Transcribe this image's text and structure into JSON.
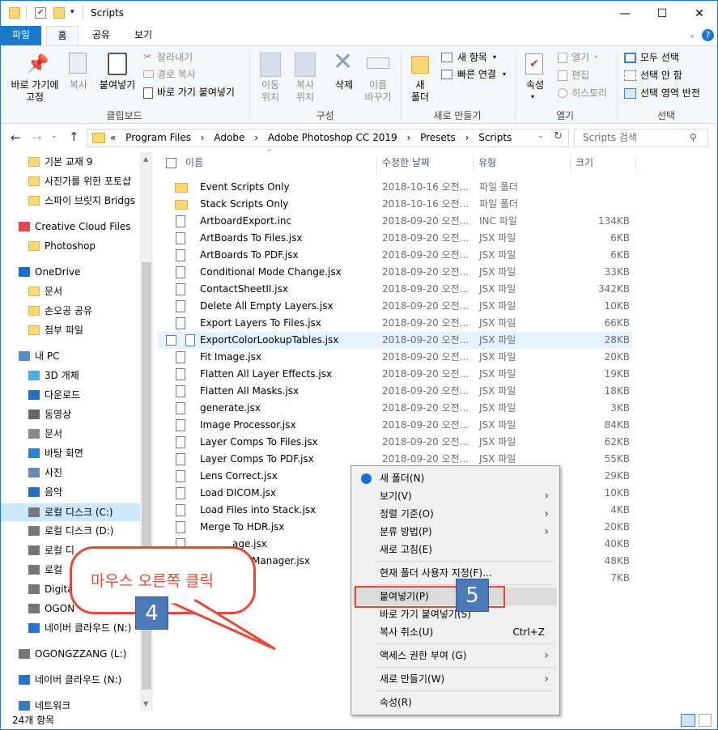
{
  "window": {
    "title": "Scripts",
    "minimize": "—",
    "maximize": "☐",
    "close": "✕"
  },
  "tabs": [
    "파일",
    "홈",
    "공유",
    "보기"
  ],
  "ribbon": {
    "clipboard": {
      "pin_label": "바로 가기에\n고정",
      "copy_label": "복사",
      "paste_label": "붙여넣기",
      "cut_label": "잘라내기",
      "copy_path_label": "경로 복사",
      "paste_shortcut_label": "바로 가기 붙여넣기",
      "group_label": "클립보드"
    },
    "organize": {
      "move_label": "이동\n위치",
      "copy_to_label": "복사\n위치",
      "delete_label": "삭제",
      "rename_label": "이름\n바꾸기",
      "group_label": "구성"
    },
    "new": {
      "new_folder_label": "새\n폴더",
      "new_item_label": "새 항목",
      "easy_access_label": "빠른 연결",
      "group_label": "새로 만들기"
    },
    "open": {
      "properties_label": "속성",
      "open_label": "열기",
      "edit_label": "편집",
      "history_label": "히스토리",
      "group_label": "열기"
    },
    "select": {
      "select_all_label": "모두 선택",
      "select_none_label": "선택 안 함",
      "invert_label": "선택 영역 반전",
      "group_label": "선택"
    }
  },
  "address": {
    "crumbs": [
      "«",
      "Program Files",
      "Adobe",
      "Adobe Photoshop CC 2019",
      "Presets",
      "Scripts"
    ],
    "search_placeholder": "Scripts 검색"
  },
  "nav": [
    {
      "label": "기본 교재 9",
      "icon": "folder-icon",
      "indent": 1
    },
    {
      "label": "사진가를 위한 포토샵",
      "icon": "folder-icon",
      "indent": 1
    },
    {
      "label": "스파이 브릿지 Bridgs",
      "icon": "folder-icon",
      "indent": 1
    },
    {
      "label": "Creative Cloud Files",
      "icon": "creative-cloud-icon",
      "indent": 0
    },
    {
      "label": "Photoshop",
      "icon": "folder-sync-icon",
      "indent": 1
    },
    {
      "label": "OneDrive",
      "icon": "onedrive-icon",
      "indent": 0
    },
    {
      "label": "문서",
      "icon": "folder-icon",
      "indent": 1
    },
    {
      "label": "손오공 공유",
      "icon": "folder-icon",
      "indent": 1
    },
    {
      "label": "첨부 파일",
      "icon": "folder-icon",
      "indent": 1
    },
    {
      "label": "내 PC",
      "icon": "pc-icon",
      "indent": 0
    },
    {
      "label": "3D 개체",
      "icon": "cube-icon",
      "indent": 1
    },
    {
      "label": "다운로드",
      "icon": "download-icon",
      "indent": 1
    },
    {
      "label": "동영상",
      "icon": "video-icon",
      "indent": 1
    },
    {
      "label": "문서",
      "icon": "document-icon",
      "indent": 1
    },
    {
      "label": "바탕 화면",
      "icon": "desktop-icon",
      "indent": 1
    },
    {
      "label": "사진",
      "icon": "picture-icon",
      "indent": 1
    },
    {
      "label": "음악",
      "icon": "music-icon",
      "indent": 1
    },
    {
      "label": "로컬 디스크 (C:)",
      "icon": "drive-c-icon",
      "indent": 1
    },
    {
      "label": "로컬 디스크 (D:)",
      "icon": "drive-icon",
      "indent": 1
    },
    {
      "label": "로컬 디",
      "icon": "drive-icon",
      "indent": 1
    },
    {
      "label": "로컬",
      "icon": "drive-icon",
      "indent": 1
    },
    {
      "label": "Digita",
      "icon": "drive-icon",
      "indent": 1
    },
    {
      "label": "OGON",
      "icon": "drive-icon",
      "indent": 1
    },
    {
      "label": "네이버 클라우드 (N:)",
      "icon": "cloud-drive-icon",
      "indent": 1
    },
    {
      "label": "OGONGZZANG (L:)",
      "icon": "drive-icon",
      "indent": 0
    },
    {
      "label": "네이버 클라우드 (N:)",
      "icon": "cloud-drive-icon",
      "indent": 0
    },
    {
      "label": "네트워크",
      "icon": "network-icon",
      "indent": 0
    }
  ],
  "columns": {
    "name": "이름",
    "date": "수정한 날짜",
    "type": "유형",
    "size": "크기"
  },
  "files": [
    {
      "name": "Event Scripts Only",
      "date": "2018-10-16 오전...",
      "type": "파일 폴더",
      "size": "",
      "folder": true
    },
    {
      "name": "Stack Scripts Only",
      "date": "2018-10-16 오전...",
      "type": "파일 폴더",
      "size": "",
      "folder": true
    },
    {
      "name": "ArtboardExport.inc",
      "date": "2018-09-20 오전...",
      "type": "INC 파일",
      "size": "134KB"
    },
    {
      "name": "ArtBoards To Files.jsx",
      "date": "2018-09-20 오전...",
      "type": "JSX 파일",
      "size": "6KB"
    },
    {
      "name": "ArtBoards To PDF.jsx",
      "date": "2018-09-20 오전...",
      "type": "JSX 파일",
      "size": "6KB"
    },
    {
      "name": "Conditional Mode Change.jsx",
      "date": "2018-09-20 오전...",
      "type": "JSX 파일",
      "size": "33KB"
    },
    {
      "name": "ContactSheetII.jsx",
      "date": "2018-09-20 오전...",
      "type": "JSX 파일",
      "size": "342KB"
    },
    {
      "name": "Delete All Empty Layers.jsx",
      "date": "2018-09-20 오전...",
      "type": "JSX 파일",
      "size": "10KB"
    },
    {
      "name": "Export Layers To Files.jsx",
      "date": "2018-09-20 오전...",
      "type": "JSX 파일",
      "size": "66KB"
    },
    {
      "name": "ExportColorLookupTables.jsx",
      "date": "2018-09-20 오전...",
      "type": "JSX 파일",
      "size": "28KB",
      "hover": true
    },
    {
      "name": "Fit Image.jsx",
      "date": "2018-09-20 오전...",
      "type": "JSX 파일",
      "size": "20KB"
    },
    {
      "name": "Flatten All Layer Effects.jsx",
      "date": "2018-09-20 오전...",
      "type": "JSX 파일",
      "size": "19KB"
    },
    {
      "name": "Flatten All Masks.jsx",
      "date": "2018-09-20 오전...",
      "type": "JSX 파일",
      "size": "18KB"
    },
    {
      "name": "generate.jsx",
      "date": "2018-09-20 오전...",
      "type": "JSX 파일",
      "size": "3KB"
    },
    {
      "name": "Image Processor.jsx",
      "date": "2018-09-20 오전...",
      "type": "JSX 파일",
      "size": "84KB"
    },
    {
      "name": "Layer Comps To Files.jsx",
      "date": "2018-09-20 오전...",
      "type": "JSX 파일",
      "size": "62KB"
    },
    {
      "name": "Layer Comps To PDF.jsx",
      "date": "2018-09-20 오전...",
      "type": "JSX 파일",
      "size": "55KB"
    },
    {
      "name": "Lens Correct.jsx",
      "date": "",
      "type": "",
      "size": "29KB"
    },
    {
      "name": "Load DICOM.jsx",
      "date": "",
      "type": "",
      "size": "10KB"
    },
    {
      "name": "Load Files into Stack.jsx",
      "date": "",
      "type": "",
      "size": "4KB"
    },
    {
      "name": "Merge To HDR.jsx",
      "date": "",
      "type": "",
      "size": "20KB"
    },
    {
      "name": "",
      "date": "",
      "type": "",
      "size": "40KB"
    },
    {
      "name": "",
      "date": "",
      "type": "",
      "size": "48KB"
    },
    {
      "name": "",
      "date": "",
      "type": "",
      "size": "7KB"
    }
  ],
  "partial_names": {
    "row22": "age.jsx",
    "row23": "Manager.jsx"
  },
  "context_menu": [
    {
      "label": "새 폴더(N)",
      "icon": "new-folder-icon"
    },
    {
      "label": "보기(V)",
      "arrow": true
    },
    {
      "label": "정렬 기준(O)",
      "arrow": true
    },
    {
      "label": "분류 방법(P)",
      "arrow": true
    },
    {
      "label": "새로 고침(E)"
    },
    {
      "sep": true
    },
    {
      "label": "현재 폴더 사용자 지정(F)..."
    },
    {
      "sep": true
    },
    {
      "label": "붙여넣기(P)",
      "highlight": true
    },
    {
      "label": "바로 가기 붙여넣기(S)"
    },
    {
      "label": "복사 취소(U)",
      "accel": "Ctrl+Z"
    },
    {
      "sep": true
    },
    {
      "label": "액세스 권한 부여 (G)",
      "arrow": true
    },
    {
      "sep": true
    },
    {
      "label": "새로 만들기(W)",
      "arrow": true
    },
    {
      "sep": true
    },
    {
      "label": "속성(R)"
    }
  ],
  "annotations": {
    "callout_text": "마우스 오른쪽 클릭",
    "badge4": "4",
    "badge5": "5"
  },
  "status": {
    "item_count": "24개 항목"
  },
  "colors": {
    "accent": "#1979ca",
    "annotation_red": "#e8473a",
    "badge_blue": "#4c79b8"
  }
}
